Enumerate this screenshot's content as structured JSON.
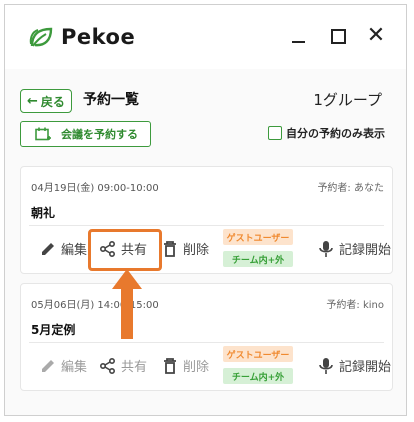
{
  "app": {
    "name": "Pekoe",
    "brand_color": "#3d9a3d"
  },
  "window": {
    "minimize_icon": "minimize-icon",
    "maximize_icon": "maximize-icon",
    "close_glyph": "✕"
  },
  "header": {
    "back_label": "戻る",
    "title": "予約一覧",
    "group_count": "1グループ",
    "book_meeting_label": "会議を予約する",
    "own_only_label": "自分の予約のみ表示"
  },
  "meetings": [
    {
      "date": "04月19日(金) 09:00-10:00",
      "owner": "予約者: あなた",
      "title": "朝礼",
      "actions": {
        "edit": "編集",
        "share": "共有",
        "delete": "削除",
        "record": "記録開始"
      },
      "tags": {
        "guest": "ゲストユーザー",
        "team": "チーム内+外"
      }
    },
    {
      "date": "05月06日(月) 14:00-15:00",
      "owner": "予約者: kino",
      "title": "5月定例",
      "actions": {
        "edit": "編集",
        "share": "共有",
        "delete": "削除",
        "record": "記録開始"
      },
      "tags": {
        "guest": "ゲストユーザー",
        "team": "チーム内+外"
      }
    }
  ],
  "colors": {
    "accent_green": "#3d9a3d",
    "highlight_orange": "#e8792d",
    "guest_tag_bg": "#fde3cc",
    "team_tag_bg": "#d6f0d6"
  }
}
